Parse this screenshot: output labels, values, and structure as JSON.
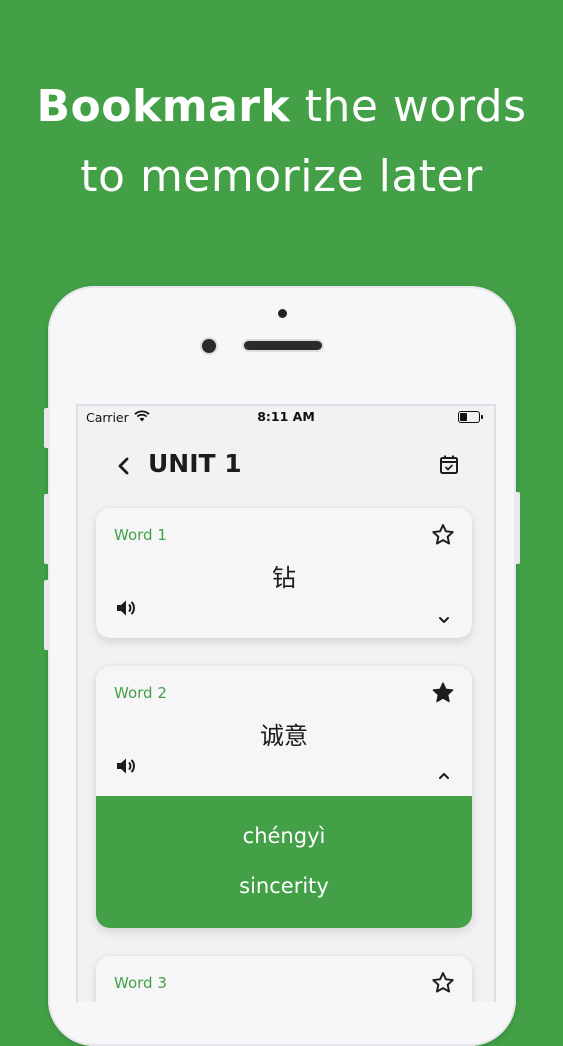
{
  "headline": {
    "bold": "Bookmark",
    "rest": " the words",
    "line2": "to memorize later"
  },
  "status": {
    "carrier": "Carrier",
    "time": "8:11 AM"
  },
  "nav": {
    "title": "UNIT 1"
  },
  "words": [
    {
      "label": "Word 1",
      "hanzi": "钻",
      "bookmarked": false,
      "expanded": false
    },
    {
      "label": "Word 2",
      "hanzi": "诚意",
      "bookmarked": true,
      "expanded": true,
      "pinyin": "chéngyì",
      "meaning": "sincerity"
    },
    {
      "label": "Word 3",
      "bookmarked": false,
      "expanded": false
    }
  ],
  "colors": {
    "accent": "#43a047",
    "background": "#43a047"
  }
}
